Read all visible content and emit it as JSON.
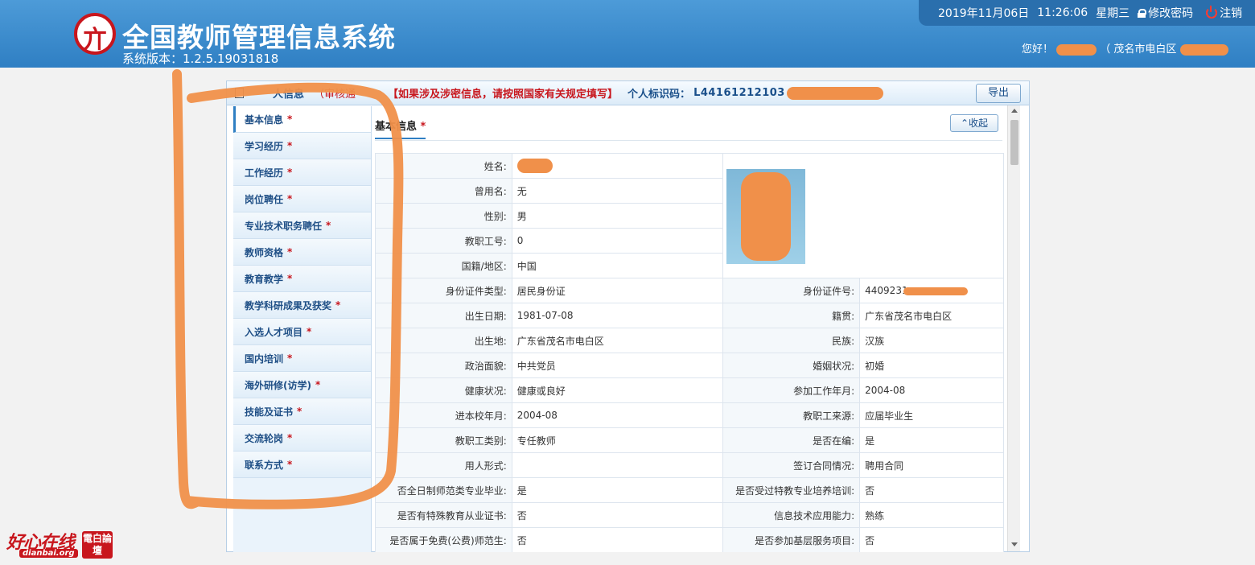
{
  "header": {
    "title": "全国教师管理信息系统",
    "version": "系统版本：1.2.5.19031818",
    "date": "2019年11月06日",
    "time": "11:26:06",
    "weekday": "星期三",
    "change_password": "修改密码",
    "logout": "注销",
    "greeting_prefix": "您好！",
    "region": "（ 茂名市电白区"
  },
  "panel": {
    "title_tail": "人信息",
    "status": "（审核通",
    "warning": "【如果涉及涉密信息，请按照国家有关规定填写】",
    "id_label": "个人标识码：",
    "id_value": "L44161212103",
    "export": "导出"
  },
  "sidebar": {
    "items": [
      {
        "label": "基本信息",
        "star": "*"
      },
      {
        "label": "学习经历",
        "star": "*"
      },
      {
        "label": "工作经历",
        "star": "*"
      },
      {
        "label": "岗位聘任",
        "star": "*"
      },
      {
        "label": "专业技术职务聘任",
        "star": "*"
      },
      {
        "label": "教师资格",
        "star": "*"
      },
      {
        "label": "教育教学",
        "star": "*"
      },
      {
        "label": "教学科研成果及获奖",
        "star": "*"
      },
      {
        "label": "入选人才项目",
        "star": "*"
      },
      {
        "label": "国内培训",
        "star": "*"
      },
      {
        "label": "海外研修(访学)",
        "star": "*"
      },
      {
        "label": "技能及证书",
        "star": "*"
      },
      {
        "label": "交流轮岗",
        "star": "*"
      },
      {
        "label": "联系方式",
        "star": "*"
      }
    ]
  },
  "section": {
    "title": "基本信息",
    "star": "*",
    "collapse": "收起"
  },
  "info": {
    "name_label": "姓名:",
    "former_name_label": "曾用名:",
    "former_name": "无",
    "gender_label": "性别:",
    "gender": "男",
    "staff_no_label": "教职工号:",
    "staff_no": "0",
    "nationality_label": "国籍/地区:",
    "nationality": "中国",
    "id_type_label": "身份证件类型:",
    "id_type": "居民身份证",
    "id_no_label": "身份证件号:",
    "id_no": "4409231",
    "birth_label": "出生日期:",
    "birth": "1981-07-08",
    "native_label": "籍贯:",
    "native": "广东省茂名市电白区",
    "birthplace_label": "出生地:",
    "birthplace": "广东省茂名市电白区",
    "ethnic_label": "民族:",
    "ethnic": "汉族",
    "political_label": "政治面貌:",
    "political": "中共党员",
    "marital_label": "婚姻状况:",
    "marital": "初婚",
    "health_label": "健康状况:",
    "health": "健康或良好",
    "work_start_label": "参加工作年月:",
    "work_start": "2004-08",
    "school_start_label": "进本校年月:",
    "school_start": "2004-08",
    "source_label": "教职工来源:",
    "source": "应届毕业生",
    "category_label": "教职工类别:",
    "category": "专任教师",
    "on_staff_label": "是否在编:",
    "on_staff": "是",
    "employ_label": "用人形式:",
    "employ": "",
    "contract_label": "签订合同情况:",
    "contract": "聘用合同",
    "fulltime_label": "否全日制师范类专业毕业:",
    "fulltime": "是",
    "special_train_label": "是否受过特教专业培养培训:",
    "special_train": "否",
    "special_cert_label": "是否有特殊教育从业证书:",
    "special_cert": "否",
    "it_label": "信息技术应用能力:",
    "it": "熟练",
    "free_label": "是否属于免费(公费)师范生:",
    "free": "否",
    "grassroots_label": "是否参加基层服务项目:",
    "grassroots": "否"
  },
  "watermark": {
    "main": "好心在线",
    "sub": "dianbai.org",
    "seal": "電白論壇"
  }
}
